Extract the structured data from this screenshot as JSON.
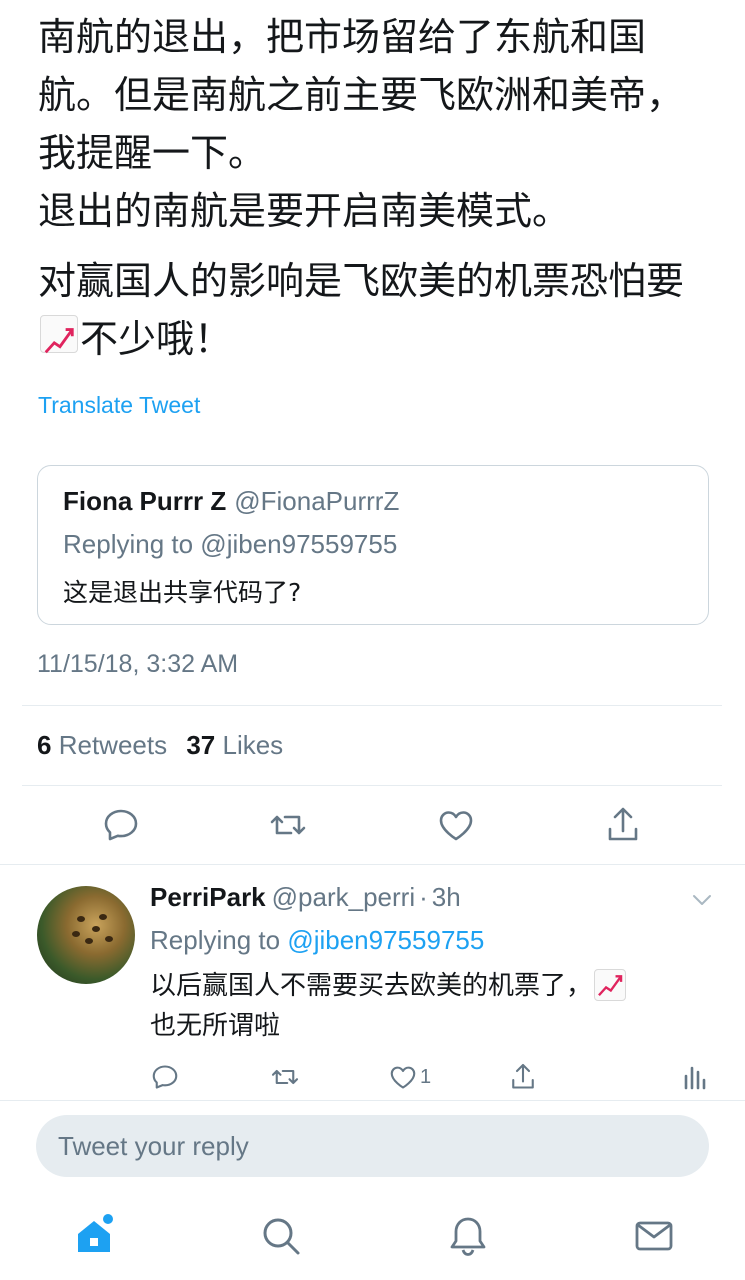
{
  "tweet": {
    "paragraph1": "南航的退出，把市场留给了东航和国航。但是南航之前主要飞欧洲和美帝，我提醒一下。",
    "paragraph1_line4": "退出的南航是要开启南美模式。",
    "paragraph2_before": "对赢国人的影响是飞欧美的机票恐怕要",
    "paragraph2_after": "不少哦！",
    "emoji": "chart-increasing-emoji",
    "translate_label": "Translate Tweet",
    "timestamp": "11/15/18, 3:32 AM"
  },
  "quoted": {
    "name": "Fiona Purrr Z",
    "handle": "@FionaPurrrZ",
    "replying_to": "Replying to @jiben97559755",
    "text": "这是退出共享代码了?"
  },
  "stats": {
    "retweets_count": "6",
    "retweets_label": "Retweets",
    "likes_count": "37",
    "likes_label": "Likes"
  },
  "reply": {
    "name": "PerriPark",
    "handle": "@park_perri",
    "separator": "·",
    "time": "3h",
    "replying_prefix": "Replying to",
    "replying_handle": "@jiben97559755",
    "text_before": "以后赢国人不需要买去欧美的机票了，",
    "text_after": "也无所谓啦",
    "like_count": "1"
  },
  "compose": {
    "placeholder": "Tweet your reply"
  },
  "colors": {
    "accent": "#1da1f2",
    "muted": "#657786",
    "text": "#14171a",
    "divider": "#e6ecf0"
  },
  "icons": {
    "actions": [
      "reply-icon",
      "retweet-icon",
      "like-icon",
      "share-icon"
    ],
    "nav": [
      "home-icon",
      "search-icon",
      "notifications-icon",
      "messages-icon"
    ]
  }
}
